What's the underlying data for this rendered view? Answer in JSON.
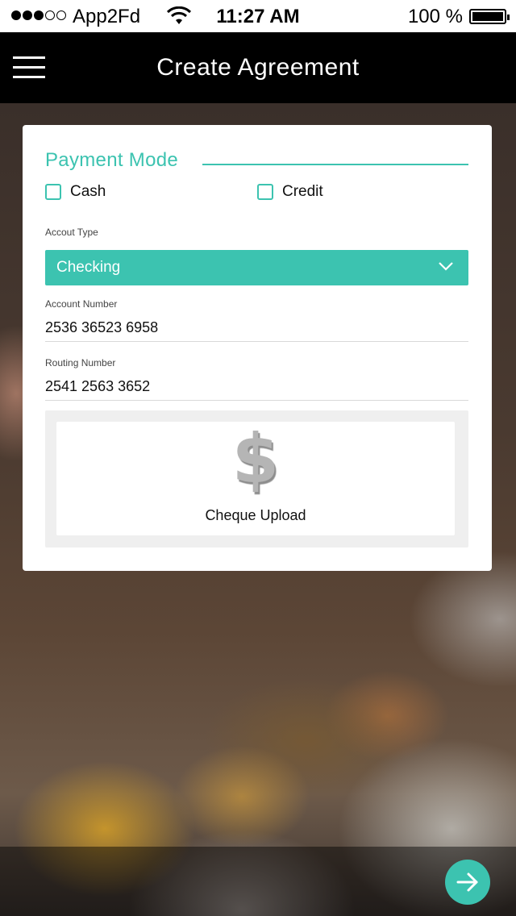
{
  "status_bar": {
    "carrier": "App2Fd",
    "time": "11:27 AM",
    "battery": "100 %",
    "signal_strength": 3,
    "signal_max": 5
  },
  "header": {
    "title": "Create Agreement"
  },
  "payment_mode": {
    "title": "Payment Mode",
    "options": [
      {
        "label": "Cash",
        "checked": false
      },
      {
        "label": "Credit",
        "checked": false
      }
    ]
  },
  "account_type": {
    "label": "Accout Type",
    "selected": "Checking"
  },
  "account_number": {
    "label": "Account Number",
    "value": "2536 36523 6958"
  },
  "routing_number": {
    "label": "Routing Number",
    "value": "2541 2563 3652"
  },
  "cheque_upload": {
    "icon": "dollar-icon",
    "label": "Cheque Upload"
  },
  "colors": {
    "accent": "#3cc3b0",
    "header_bg": "#000000"
  }
}
